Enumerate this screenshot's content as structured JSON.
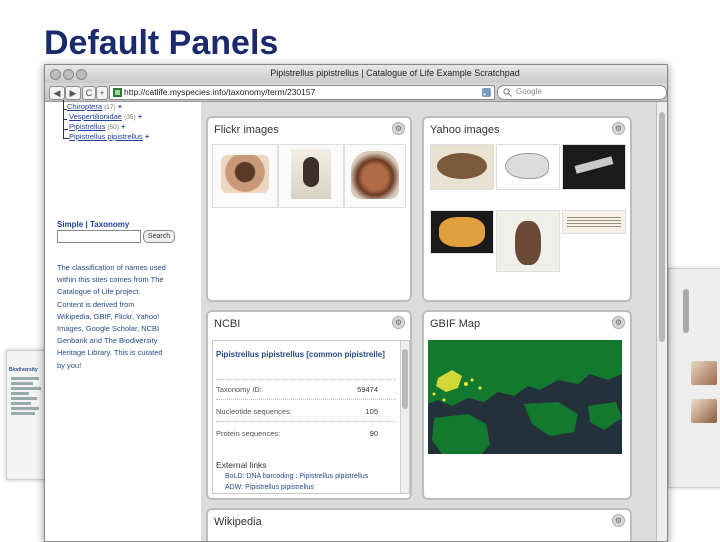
{
  "slide": {
    "title": "Default Panels"
  },
  "browser": {
    "window_title": "Pipistrellus pipistrellus | Catalogue of Life Example Scratchpad",
    "url": "http://catlife.myspecies.info/taxonomy/term/230157",
    "search_placeholder": "Google",
    "nav": {
      "back": "◀",
      "forward": "▶",
      "reload": "C",
      "add": "+"
    }
  },
  "sidebar": {
    "tree": [
      {
        "name": "Chiroptera",
        "count": "(17)",
        "plus": "+"
      },
      {
        "name": "Vespertilionidae",
        "count": "(35)",
        "plus": "+"
      },
      {
        "name": "Pipistrellus",
        "count": "(50)",
        "plus": "+"
      },
      {
        "name": "Pipistrellus pipistrellus",
        "count": "",
        "plus": "+"
      }
    ],
    "tabs": {
      "simple": "Simple",
      "sep": "|",
      "taxonomy": "Taxonomy"
    },
    "search_button": "Search",
    "intro_lines": [
      "The classification of names used",
      "within this sites comes from The",
      "Catalogue of Life project.",
      "Content is derived from",
      "Wikipedia, GBIF, Flickr, Yahoo!",
      "Images, Google Scholar, NCBI",
      "Genbank and The Biodiversity",
      "Heritage Library. This is curated",
      "by you!"
    ]
  },
  "panels": {
    "flickr": {
      "title": "Flickr images"
    },
    "yahoo": {
      "title": "Yahoo images"
    },
    "ncbi": {
      "title": "NCBI",
      "heading": "Pipistrellus pipistrellus [common pipistrelle]",
      "rows": [
        {
          "label": "Taxonomy ID:",
          "value": "59474"
        },
        {
          "label": "Nucleotide sequences:",
          "value": "105"
        },
        {
          "label": "Protein sequences:",
          "value": "90"
        }
      ],
      "external_title": "External links",
      "links": [
        "BoLD: DNA barcoding : Pipistrellus pipistrellus",
        "ADW: Pipistrellus pipistrellus"
      ]
    },
    "gbif": {
      "title": "GBIF Map"
    },
    "wikipedia": {
      "title": "Wikipedia"
    }
  },
  "background_window": {
    "heading": "Biodiversity"
  },
  "colors": {
    "title": "#1a2a6c",
    "link": "#1f3f9a",
    "map_sea": "#23323a",
    "map_land": "#12792f",
    "map_points": "#f2e83a"
  },
  "icons": [
    "gear-icon",
    "search-icon",
    "rss-icon",
    "close-icon"
  ]
}
